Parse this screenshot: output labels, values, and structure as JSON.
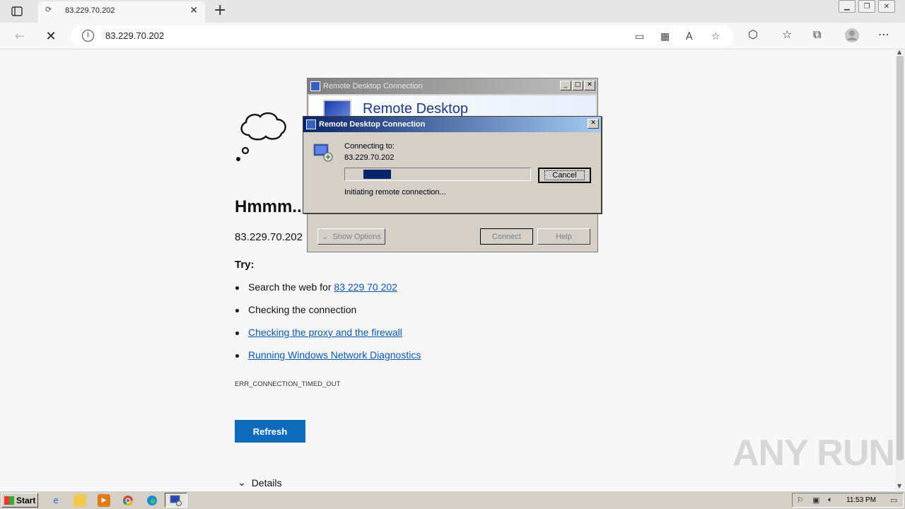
{
  "browser": {
    "tab_title": "83.229.70.202",
    "new_tab_glyph": "+",
    "url": "83.229.70.202"
  },
  "error_page": {
    "title": "Hmmm...",
    "host": "83.229.70.202",
    "try_label": "Try:",
    "suggestions": [
      {
        "text_prefix": "Search the web for ",
        "link": "83 229 70 202"
      },
      {
        "text": "Checking the connection"
      },
      {
        "link": "Checking the proxy and the firewall"
      },
      {
        "link": "Running Windows Network Diagnostics"
      }
    ],
    "error_code": "ERR_CONNECTION_TIMED_OUT",
    "refresh_label": "Refresh",
    "details_label": "Details"
  },
  "rdp_back": {
    "title": "Remote Desktop Connection",
    "banner": "Remote Desktop",
    "show_options": "Show Options",
    "connect": "Connect",
    "help": "Help"
  },
  "rdp_front": {
    "title": "Remote Desktop Connection",
    "connecting_label": "Connecting to:",
    "host": "83.229.70.202",
    "progress": 0.15,
    "status": "Initiating remote connection...",
    "cancel": "Cancel"
  },
  "taskbar": {
    "start_label": "Start",
    "clock": "11:53 PM"
  },
  "watermark": "ANY RUN",
  "colors": {
    "accent": "#0f6cbd",
    "link": "#0a58b4",
    "xp_title_active": "#0a246a"
  }
}
